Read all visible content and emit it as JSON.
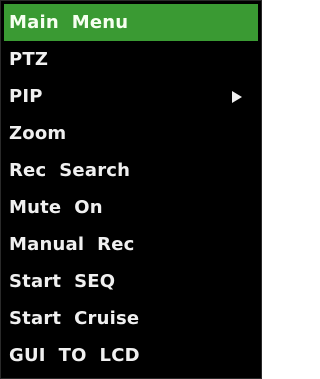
{
  "menu": {
    "items": [
      {
        "label": "Main  Menu",
        "selected": true
      },
      {
        "label": "PTZ"
      },
      {
        "label": "PIP",
        "has_submenu": true
      },
      {
        "label": "Zoom"
      },
      {
        "label": "Rec  Search"
      },
      {
        "label": "Mute  On"
      },
      {
        "label": "Manual  Rec"
      },
      {
        "label": "Start  SEQ"
      },
      {
        "label": "Start  Cruise"
      },
      {
        "label": "GUI  TO  LCD"
      }
    ],
    "submenu_icon": "triangle-right-icon",
    "colors": {
      "background": "#000000",
      "selected_background": "#3a9a33",
      "text": "#f0f0f0"
    }
  }
}
